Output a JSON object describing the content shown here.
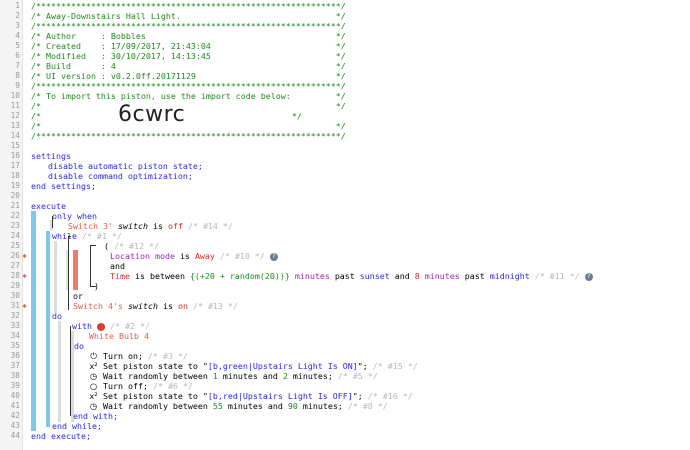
{
  "header_block": {
    "l1": "/*************************************************************/",
    "l2": "/* Away-Downstairs Hall Light.                               */",
    "l3": "/*************************************************************/",
    "l4": "/* Author     : Bobbles                                      */",
    "l5": "/* Created    : 17/09/2017, 21:43:04                         */",
    "l6": "/* Modified   : 30/10/2017, 14:13:45                         */",
    "l7": "/* Build      : 4                                            */",
    "l8": "/* UI version : v0.2.0ff.20171129                            */",
    "l9": "/*************************************************************/",
    "l10": "/* To import this piston, use the import code below:         */",
    "l11": "/*                                                           */",
    "l12a": "/*",
    "l12b": "*/",
    "l13": "/*                                                           */",
    "l14": "/*************************************************************/",
    "import_code": "6cwrc"
  },
  "settings": {
    "open": "settings",
    "line1": "disable automatic piston state;",
    "line2": "disable command optimization;",
    "close": "end settings;"
  },
  "execute": {
    "open": "execute",
    "only_when": "only when",
    "cond1_device": "Switch 3",
    "cond1_suffix": "'",
    "cond1_attr": "switch",
    "cond1_is": "is",
    "cond1_value": "off",
    "cond1_cm": "/* #14 */",
    "while": "while",
    "while_cm": "/* #1 */",
    "paren_open": "(",
    "paren_cm": "/* #12 */",
    "loc_attr": "Location mode",
    "loc_is": "is",
    "loc_value": "Away",
    "loc_cm": "/* #10 */",
    "and": "and",
    "time_attr": "Time",
    "time_is_between": "is between",
    "time_expr": "{(+20 + random(20))}",
    "time_minutes1": "minutes",
    "time_past1": "past",
    "time_sunset": "sunset",
    "time_and": "and",
    "time_num2": "8",
    "time_minutes2": "minutes",
    "time_past2": "past",
    "time_midnight": "midnight",
    "time_cm": "/* #11 */",
    "paren_close": ")",
    "or": "or",
    "cond2_device": "Switch 4",
    "cond2_suffix": "'s",
    "cond2_attr": "switch",
    "cond2_is": "is",
    "cond2_value": "on",
    "cond2_cm": "/* #13 */",
    "do": "do",
    "with": "with",
    "with_cm": "/* #2 */",
    "with_device": "White Bulb 4",
    "with_do": "do",
    "a1_text": "Turn on;",
    "a1_cm": "/* #3 */",
    "a2_text1": "Set piston state to \"",
    "a2_value": "[b,green|Upstairs Light Is ON]",
    "a2_text2": "\";",
    "a2_cm": "/* #15 */",
    "a3_text1": "Wait randomly between",
    "a3_n1": "1",
    "a3_text2": "minutes and",
    "a3_n2": "2",
    "a3_text3": "minutes;",
    "a3_cm": "/* #5 */",
    "a4_text": "Turn off;",
    "a4_cm": "/* #6 */",
    "a5_text1": "Set piston state to \"",
    "a5_value": "[b,red|Upstairs Light Is OFF]",
    "a5_text2": "\";",
    "a5_cm": "/* #16 */",
    "a6_text1": "Wait randomly between",
    "a6_n1": "55",
    "a6_text2": "minutes and",
    "a6_n2": "90",
    "a6_text3": "minutes;",
    "a6_cm": "/* #8 */",
    "end_with": "end with;",
    "end_while": "end while;",
    "close": "end execute;"
  },
  "line_numbers": [
    "1",
    "2",
    "3",
    "4",
    "5",
    "6",
    "7",
    "8",
    "9",
    "10",
    "11",
    "12",
    "13",
    "14",
    "15",
    "16",
    "17",
    "18",
    "19",
    "20",
    "21",
    "22",
    "23",
    "24",
    "25",
    "26",
    "27",
    "28",
    "29",
    "30",
    "31",
    "32",
    "33",
    "34",
    "35",
    "36",
    "37",
    "38",
    "39",
    "40",
    "41",
    "42",
    "43",
    "44"
  ],
  "icons": {
    "turn_on": "power-icon",
    "set_state": "variable-icon",
    "wait": "clock-icon",
    "turn_off": "power-off-icon",
    "info": "info-icon",
    "location": "location-icon"
  }
}
